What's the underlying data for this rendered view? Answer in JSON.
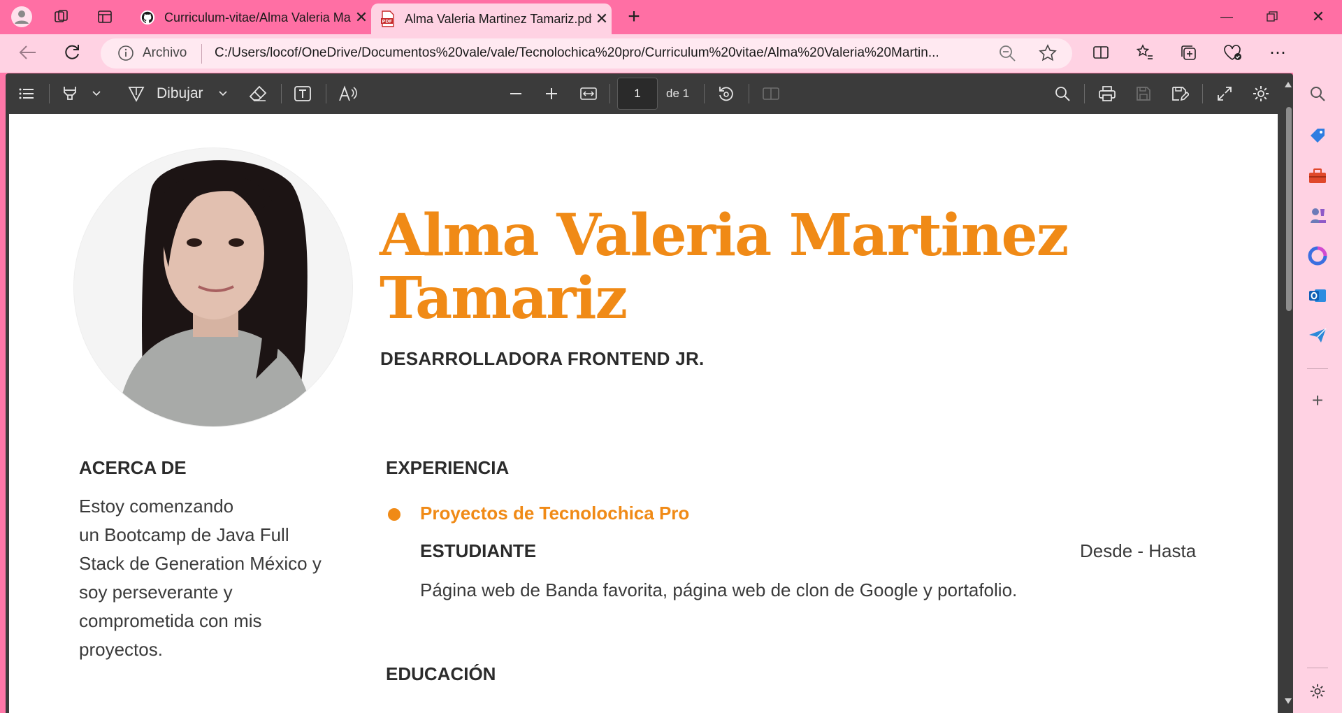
{
  "browser": {
    "tabs": [
      {
        "title": "Curriculum-vitae/Alma Valeria Ma",
        "icon": "github-icon",
        "active": false
      },
      {
        "title": "Alma Valeria Martinez Tamariz.pdf",
        "icon": "pdf-icon",
        "active": true
      }
    ],
    "address": {
      "scheme_label": "Archivo",
      "url": "C:/Users/locof/OneDrive/Documentos%20vale/vale/Tecnolochica%20pro/Curriculum%20vitae/Alma%20Valeria%20Martin..."
    }
  },
  "pdf_toolbar": {
    "draw_label": "Dibujar",
    "page_current": "1",
    "page_total_label": "de 1"
  },
  "resume": {
    "name_line1": "Alma Valeria Martinez",
    "name_line2": "Tamariz",
    "role": "DESARROLLADORA FRONTEND JR.",
    "about_heading": "ACERCA DE",
    "about_lines": [
      "Estoy comenzando",
      "un Bootcamp de Java Full",
      "Stack  de Generation México y",
      "soy perseverante y",
      "comprometida con mis",
      "proyectos."
    ],
    "experience_heading": "EXPERIENCIA",
    "experience": {
      "project": "Proyectos de Tecnolochica Pro",
      "title": "ESTUDIANTE",
      "dates": "Desde - Hasta",
      "description": "Página web de Banda favorita, página web de clon de Google y portafolio."
    },
    "education_heading": "EDUCACIÓN"
  },
  "colors": {
    "accent_orange": "#f08a16",
    "tabstrip_pink": "#ff6fa4",
    "chrome_pink": "#ffd2e3",
    "pdf_toolbar": "#3b3b3b"
  }
}
